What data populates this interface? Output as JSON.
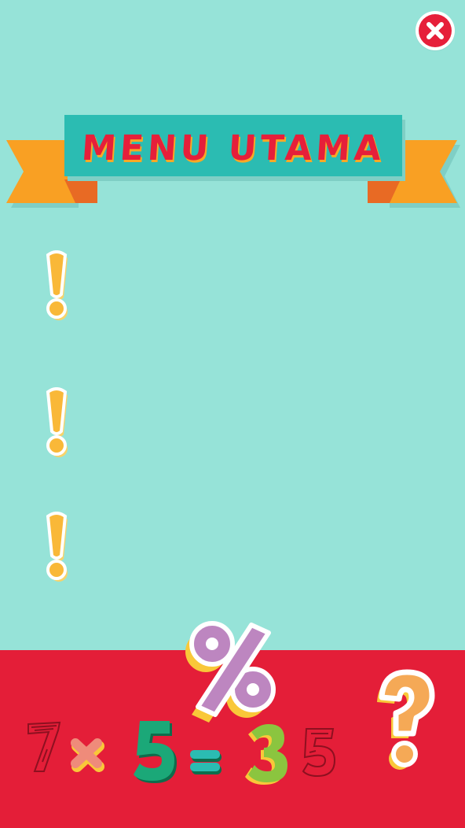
{
  "header": {
    "title": "MENU UTAMA",
    "close_icon": "close-icon"
  },
  "notices": [
    {
      "icon": "exclamation-icon"
    },
    {
      "icon": "exclamation-icon"
    },
    {
      "icon": "exclamation-icon"
    }
  ],
  "decoration": {
    "percent": "%",
    "question": "?",
    "equation": [
      "7",
      "×",
      "5",
      "=",
      "3",
      "5"
    ]
  },
  "colors": {
    "background": "#96e3d8",
    "banner": "#2bbcb2",
    "ribbon": "#f9a023",
    "accent_red": "#e41e38",
    "exclamation": "#f9b838",
    "percent": "#bd86c0",
    "question": "#f5a956",
    "five": "#1ba878",
    "three": "#8bc53f"
  }
}
